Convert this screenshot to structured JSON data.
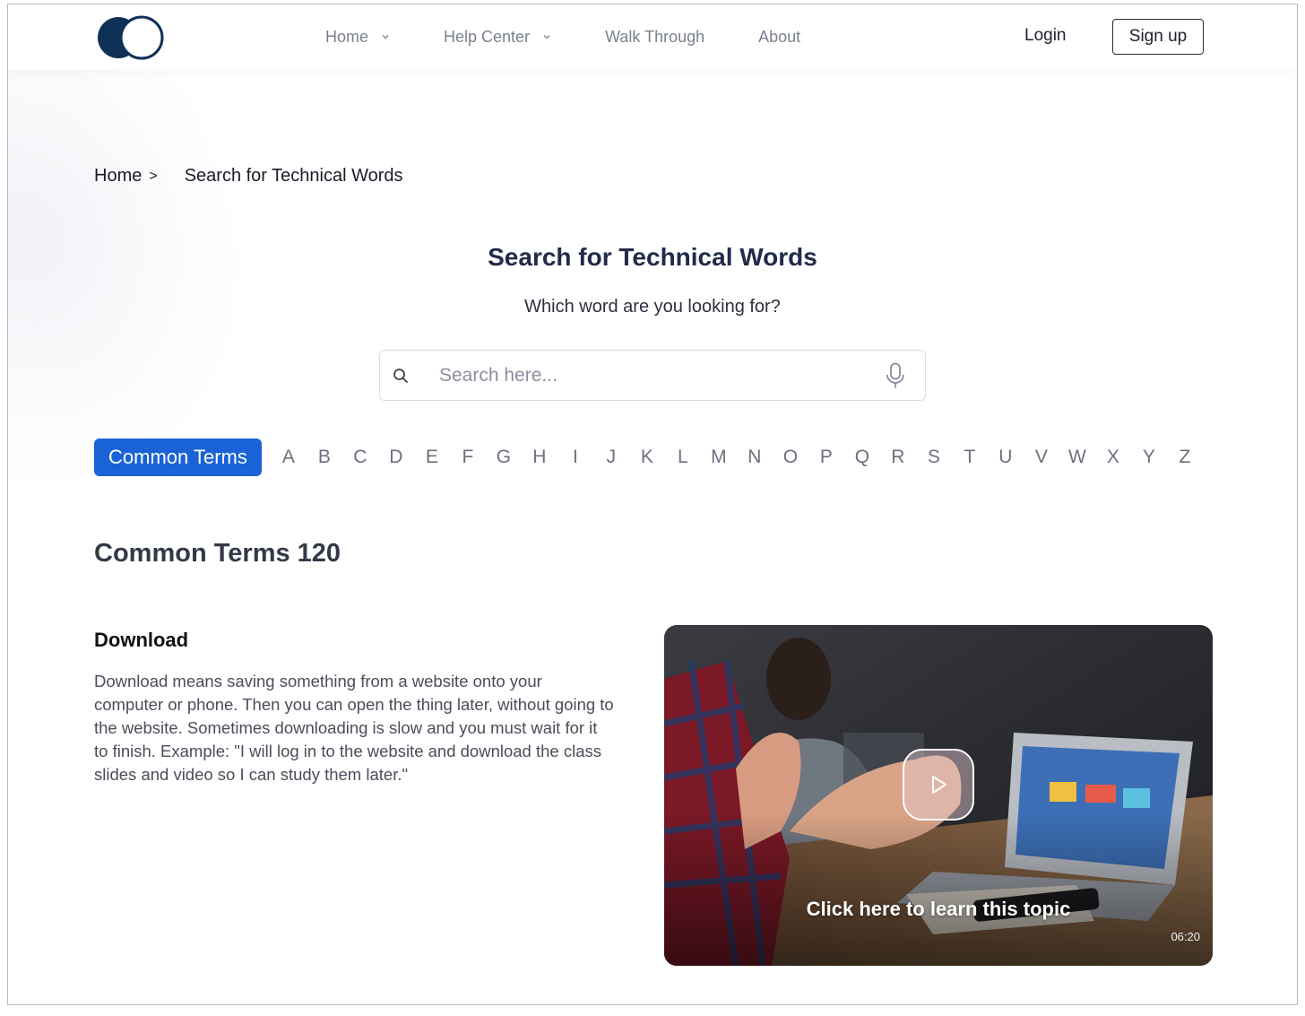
{
  "nav": {
    "items": [
      {
        "label": "Home",
        "has_dropdown": true
      },
      {
        "label": "Help Center",
        "has_dropdown": true
      },
      {
        "label": "Walk Through",
        "has_dropdown": false
      },
      {
        "label": "About",
        "has_dropdown": false
      }
    ],
    "login_label": "Login",
    "signup_label": "Sign up"
  },
  "breadcrumb": {
    "home": "Home",
    "separator": ">",
    "current": "Search for Technical Words"
  },
  "page": {
    "title": "Search for Technical Words",
    "subtitle": "Which word are you looking for?"
  },
  "search": {
    "placeholder": "Search here...",
    "value": ""
  },
  "filter": {
    "active_label": "Common Terms",
    "letters": [
      "A",
      "B",
      "C",
      "D",
      "E",
      "F",
      "G",
      "H",
      "I",
      "J",
      "K",
      "L",
      "M",
      "N",
      "O",
      "P",
      "Q",
      "R",
      "S",
      "T",
      "U",
      "V",
      "W",
      "X",
      "Y",
      "Z"
    ]
  },
  "section": {
    "title": "Common Terms 120"
  },
  "term": {
    "title": "Download",
    "description": "Download means saving something from a website onto your computer or phone.  Then you can open the thing later, without going to the website.  Sometimes downloading is slow and you must wait for it to finish.  Example: \"I will log in to the website and download the class slides and video so I can study them later.\""
  },
  "video": {
    "caption": "Click here to learn this topic",
    "duration": "06:20"
  },
  "colors": {
    "accent": "#1a63d6",
    "logo": "#0f3057",
    "title": "#232a4a"
  }
}
